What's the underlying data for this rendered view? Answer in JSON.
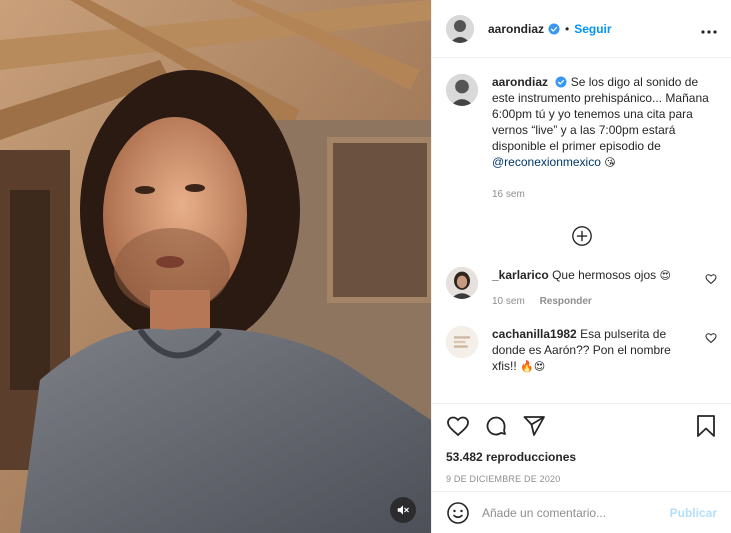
{
  "post": {
    "username": "aarondiaz",
    "follow_label": "Seguir",
    "more_icon": "more-horizontal-icon",
    "caption": {
      "username": "aarondiaz",
      "text": "Se los digo al sonido de este instrumento prehispánico... Mañana 6:00pm tú y yo tenemos una cita para vernos “live” y a las 7:00pm estará disponible el primer episodio de ",
      "mention": "@reconexionmexico",
      "emoji": "😘",
      "time": "16 sem"
    },
    "load_more_icon": "plus-circle-icon",
    "comments": [
      {
        "username": "_karlarico",
        "text": "Que hermosos ojos ",
        "emoji": "😍",
        "time": "10 sem",
        "reply_label": "Responder"
      },
      {
        "username": "cachanilla1982",
        "text": "Esa pulserita de donde es Aarón?? Pon el nombre xfis!! ",
        "emoji": "🔥😍"
      }
    ],
    "views": "53.482 reproducciones",
    "date": "9 DE DICIEMBRE DE 2020",
    "add_comment_placeholder": "Añade un comentario...",
    "publish_label": "Publicar"
  },
  "colors": {
    "accent": "#0095f6",
    "publish_disabled": "#b2dffc",
    "muted_text": "#8e8e8e",
    "border": "#efefef",
    "mention": "#00376b"
  }
}
